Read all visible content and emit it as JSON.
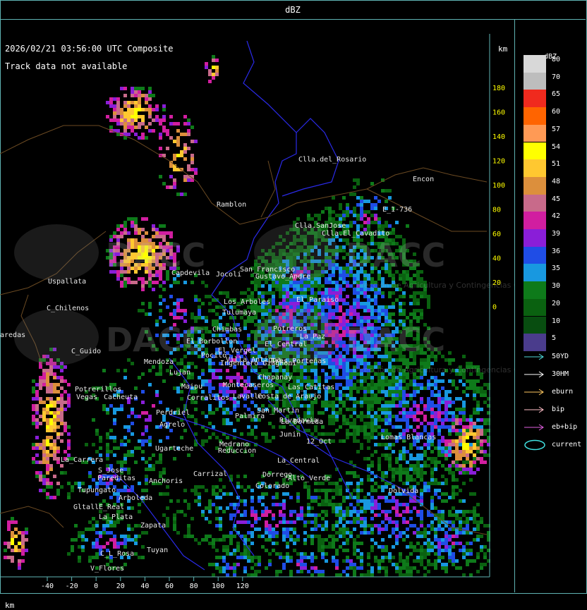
{
  "header": {
    "title": "dBZ"
  },
  "map": {
    "timestamp": "2026/02/21 03:56:00 UTC Composite",
    "track_note": "Track data not available",
    "km_label_top": "km",
    "km_label_bottom": "km",
    "y_ticks": [
      "180",
      "160",
      "140",
      "120",
      "100",
      "80",
      "60",
      "40",
      "20",
      "0"
    ],
    "x_ticks": [
      "-40",
      "-20",
      "0",
      "20",
      "40",
      "60",
      "80",
      "100",
      "120"
    ],
    "watermark": {
      "logo_text": "DACC",
      "caption": "Dirección de Agricultura y Contingencias Climáticas"
    },
    "places": [
      "Clla.del_Rosario",
      "Encon",
      "Ramblon",
      "E_1-736",
      "Clla.SanJose",
      "Clla.El_Cavadito",
      "Uspallata",
      "C_Chilenos",
      "aredas",
      "C_Guido",
      "Potrerillos",
      "Vegas",
      "Cacheuta",
      "Perdriel",
      "Agrelo",
      "Ugarteche",
      "La_Carrera",
      "S_Jose",
      "Pareditas",
      "Tupungato",
      "Arboleda",
      "Gltall",
      "E_Real",
      "La_Plata",
      "Zapata",
      "C_L_Rosa",
      "Tuyan",
      "V_Flores",
      "Anchoris",
      "Carrizal",
      "Medrano",
      "Reduccion",
      "Junin",
      "Rivadavia",
      "12_Oct",
      "Alto_Verde",
      "La_Central",
      "Dorrego",
      "Colorado",
      "Dolvida",
      "Lomas_Blancas",
      "Mendoza",
      "Lujan",
      "Maipu",
      "Corralitos",
      "Lavalle",
      "Costa_de_Araujo",
      "Tres_Porteñas",
      "Chapanay",
      "El_Central",
      "San_Martin",
      "Palmira",
      "La_Dormida",
      "Las_Catitas",
      "Tulumaya",
      "Jocoli",
      "Capdevila",
      "El_Borbollon",
      "Chimbas",
      "El_Vergel",
      "Ingeniero_Giagnoni",
      "Montecaseros",
      "Gustavo_Andre",
      "San_Francisco",
      "Los_Arboles",
      "Pocito",
      "Potreros",
      "El_Paraiso",
      "La_Paz",
      "Villa_Antigua"
    ]
  },
  "legend": {
    "title": "dBZ",
    "scale": [
      {
        "label": "80",
        "color": "#d8d8d8"
      },
      {
        "label": "70",
        "color": "#bdbdbd"
      },
      {
        "label": "65",
        "color": "#f02a1e"
      },
      {
        "label": "60",
        "color": "#ff6400"
      },
      {
        "label": "57",
        "color": "#ff9a55"
      },
      {
        "label": "54",
        "color": "#ffff00"
      },
      {
        "label": "51",
        "color": "#ffc830"
      },
      {
        "label": "48",
        "color": "#dc8f3c"
      },
      {
        "label": "45",
        "color": "#c86a8a"
      },
      {
        "label": "42",
        "color": "#d11ea0"
      },
      {
        "label": "39",
        "color": "#8a1ed8"
      },
      {
        "label": "36",
        "color": "#1f4de6"
      },
      {
        "label": "35",
        "color": "#1898e0"
      },
      {
        "label": "30",
        "color": "#0e7a1a"
      },
      {
        "label": "20",
        "color": "#0a6110"
      },
      {
        "label": "10",
        "color": "#084d10"
      },
      {
        "label": "5",
        "color": "#4a3c8c"
      }
    ],
    "tracks": [
      {
        "label": "50YD",
        "color": "#4fd8d8"
      },
      {
        "label": "30HM",
        "color": "#ffffff"
      },
      {
        "label": "eburn",
        "color": "#ffc860"
      },
      {
        "label": "bip",
        "color": "#ffbfc8"
      },
      {
        "label": "eb+bip",
        "color": "#e060e0"
      },
      {
        "label": "current",
        "color": "#40e0e0"
      }
    ]
  }
}
